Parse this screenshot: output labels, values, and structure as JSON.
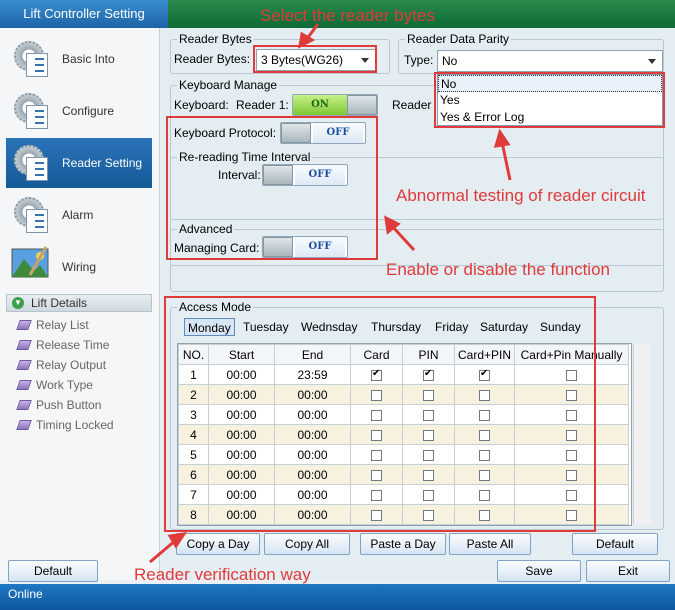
{
  "window": {
    "title": "Lift Controller Setting"
  },
  "sidebar": {
    "items": [
      {
        "label": "Basic Into",
        "icon": "gear-document-icon"
      },
      {
        "label": "Configure",
        "icon": "gear-document-icon"
      },
      {
        "label": "Reader Setting",
        "icon": "gear-document-icon",
        "active": true
      },
      {
        "label": "Alarm",
        "icon": "gear-document-icon"
      },
      {
        "label": "Wiring",
        "icon": "landscape-picture-icon"
      }
    ],
    "section_header": "Lift Details",
    "sub_items": [
      "Relay List",
      "Release Time",
      "Relay Output",
      "Work Type",
      "Push Button",
      "Timing Locked"
    ]
  },
  "reader_bytes": {
    "legend": "Reader Bytes",
    "label": "Reader Bytes:",
    "value": "3 Bytes(WG26)"
  },
  "parity": {
    "legend": "Reader Data Parity",
    "label": "Type:",
    "value": "No",
    "options": [
      "No",
      "Yes",
      "Yes & Error Log"
    ]
  },
  "keyboard": {
    "legend": "Keyboard Manage",
    "label": "Keyboard:",
    "reader1_label": "Reader 1:",
    "reader1_state": "ON",
    "reader2_label": "Reader",
    "protocol_label": "Keyboard Protocol:",
    "protocol_state": "OFF"
  },
  "reread": {
    "legend": "Re-reading Time Interval",
    "label": "Interval:",
    "state": "OFF"
  },
  "advanced": {
    "legend": "Advanced",
    "label": "Managing Card:",
    "state": "OFF"
  },
  "access_mode": {
    "legend": "Access Mode",
    "days": [
      "Monday",
      "Tuesday",
      "Wednsday",
      "Thursday",
      "Friday",
      "Saturday",
      "Sunday"
    ],
    "columns": [
      "NO.",
      "Start",
      "End",
      "Card",
      "PIN",
      "Card+PIN",
      "Card+Pin Manually"
    ],
    "rows": [
      {
        "no": "1",
        "start": "00:00",
        "end": "23:59",
        "card": true,
        "pin": true,
        "card_pin": true,
        "manual": false
      },
      {
        "no": "2",
        "start": "00:00",
        "end": "00:00",
        "card": false,
        "pin": false,
        "card_pin": false,
        "manual": false
      },
      {
        "no": "3",
        "start": "00:00",
        "end": "00:00",
        "card": false,
        "pin": false,
        "card_pin": false,
        "manual": false
      },
      {
        "no": "4",
        "start": "00:00",
        "end": "00:00",
        "card": false,
        "pin": false,
        "card_pin": false,
        "manual": false
      },
      {
        "no": "5",
        "start": "00:00",
        "end": "00:00",
        "card": false,
        "pin": false,
        "card_pin": false,
        "manual": false
      },
      {
        "no": "6",
        "start": "00:00",
        "end": "00:00",
        "card": false,
        "pin": false,
        "card_pin": false,
        "manual": false
      },
      {
        "no": "7",
        "start": "00:00",
        "end": "00:00",
        "card": false,
        "pin": false,
        "card_pin": false,
        "manual": false
      },
      {
        "no": "8",
        "start": "00:00",
        "end": "00:00",
        "card": false,
        "pin": false,
        "card_pin": false,
        "manual": false
      }
    ]
  },
  "buttons": {
    "copy_day": "Copy a Day",
    "copy_all": "Copy All",
    "paste_day": "Paste a Day",
    "paste_all": "Paste All",
    "default_right": "Default",
    "default_left": "Default",
    "save": "Save",
    "exit": "Exit"
  },
  "annotations": {
    "select_bytes": "Select the reader bytes",
    "abnormal": "Abnormal testing of reader circuit",
    "enable_disable": "Enable or disable the function",
    "verification": "Reader verification way"
  },
  "status": "Online",
  "colors": {
    "accent_blue": "#1d63a8",
    "annotation_red": "#e03a3a",
    "title_green": "#0f6a35"
  }
}
